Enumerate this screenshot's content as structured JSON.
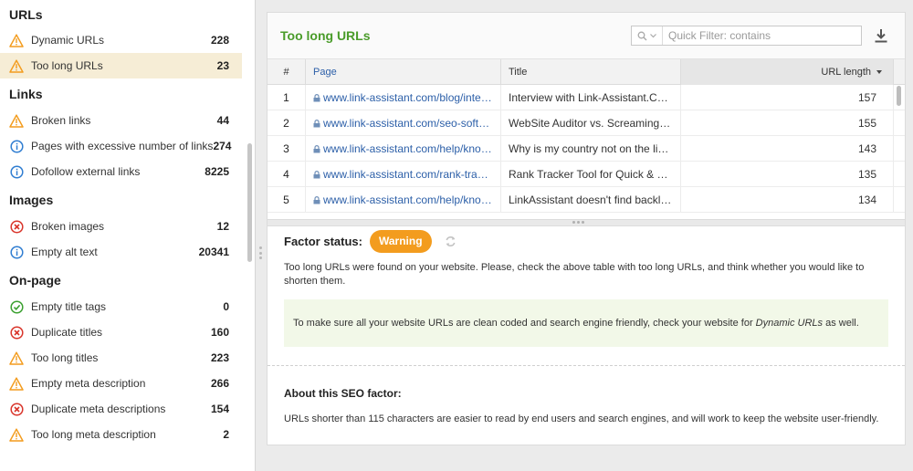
{
  "sidebar": {
    "sections": [
      {
        "title": "URLs",
        "items": [
          {
            "label": "Dynamic URLs",
            "count": "228",
            "status": "warning",
            "icon": "warning-icon"
          },
          {
            "label": "Too long URLs",
            "count": "23",
            "status": "warning",
            "icon": "warning-icon",
            "selected": true
          }
        ]
      },
      {
        "title": "Links",
        "items": [
          {
            "label": "Broken links",
            "count": "44",
            "status": "warning",
            "icon": "warning-icon"
          },
          {
            "label": "Pages with excessive number of links",
            "count": "274",
            "status": "info",
            "icon": "info-icon"
          },
          {
            "label": "Dofollow external links",
            "count": "8225",
            "status": "info",
            "icon": "info-icon"
          }
        ]
      },
      {
        "title": "Images",
        "items": [
          {
            "label": "Broken images",
            "count": "12",
            "status": "error",
            "icon": "error-icon"
          },
          {
            "label": "Empty alt text",
            "count": "20341",
            "status": "info",
            "icon": "info-icon"
          }
        ]
      },
      {
        "title": "On-page",
        "items": [
          {
            "label": "Empty title tags",
            "count": "0",
            "status": "ok",
            "icon": "check-icon"
          },
          {
            "label": "Duplicate titles",
            "count": "160",
            "status": "error",
            "icon": "error-icon"
          },
          {
            "label": "Too long titles",
            "count": "223",
            "status": "warning",
            "icon": "warning-icon"
          },
          {
            "label": "Empty meta description",
            "count": "266",
            "status": "warning",
            "icon": "warning-icon"
          },
          {
            "label": "Duplicate meta descriptions",
            "count": "154",
            "status": "error",
            "icon": "error-icon"
          },
          {
            "label": "Too long meta description",
            "count": "2",
            "status": "warning",
            "icon": "warning-icon"
          }
        ]
      }
    ]
  },
  "panel": {
    "title": "Too long URLs",
    "filter_placeholder": "Quick Filter: contains",
    "filter_value": ""
  },
  "table": {
    "columns": [
      "#",
      "Page",
      "Title",
      "URL length"
    ],
    "sorted_column": "URL length",
    "rows": [
      {
        "num": "1",
        "page": "www.link-assistant.com/blog/intervi...",
        "title": "Interview with Link-Assistant.Com...",
        "length": "157"
      },
      {
        "num": "2",
        "page": "www.link-assistant.com/seo-softwa...",
        "title": "WebSite Auditor vs. Screaming F...",
        "length": "155"
      },
      {
        "num": "3",
        "page": "www.link-assistant.com/help/knowl...",
        "title": "Why is my country not on the list ...",
        "length": "143"
      },
      {
        "num": "4",
        "page": "www.link-assistant.com/rank-track...",
        "title": "Rank Tracker Tool for Quick & E...",
        "length": "135"
      },
      {
        "num": "5",
        "page": "www.link-assistant.com/help/knowl...",
        "title": "LinkAssistant doesn't find backlin...",
        "length": "134"
      }
    ]
  },
  "details": {
    "factor_label": "Factor status:",
    "status_badge": "Warning",
    "status_text": "Too long URLs were found on your website. Please, check the above table with too long URLs, and think whether you would like to shorten them.",
    "tip_prefix": "To make sure all your website URLs are clean coded and search engine friendly, check your website for ",
    "tip_link": "Dynamic URLs",
    "tip_suffix": " as well.",
    "about_title": "About this SEO factor:",
    "about_text": "URLs shorter than 115 characters are easier to read by end users and search engines, and will work to keep the website user-friendly."
  },
  "colors": {
    "accent_green": "#4a9c2a",
    "warning_orange": "#f39c1e",
    "error_red": "#d9352b",
    "info_blue": "#2f7dd1",
    "ok_green": "#3aa02f",
    "link_blue": "#2c5fa8",
    "selected_bg": "#f6edd6"
  }
}
